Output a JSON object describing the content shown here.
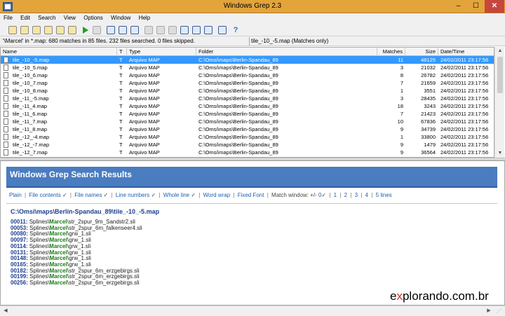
{
  "window": {
    "title": "Windows Grep 2.3",
    "min": "–",
    "max": "☐",
    "close": "✕"
  },
  "menu": [
    "File",
    "Edit",
    "Search",
    "View",
    "Options",
    "Window",
    "Help"
  ],
  "status": {
    "summary": "'\\Marcel' in *.map: 680 matches in 85 files. 232 files searched. 0 files skipped.",
    "selected": "tile_-10_-5.map (Matches only)"
  },
  "columns": {
    "name": "Name",
    "t": "T",
    "type": "Type",
    "folder": "Folder",
    "matches": "Matches",
    "size": "Size",
    "date": "Date/Time"
  },
  "rows": [
    {
      "name": "tile_-10_-5.map",
      "t": "T",
      "type": "Arquivo MAP",
      "folder": "C:\\Omsi\\maps\\Berlin-Spandau_89",
      "matches": "11",
      "size": "48125",
      "date": "24/02/2011 23:17:56",
      "selected": true
    },
    {
      "name": "tile_-10_5.map",
      "t": "T",
      "type": "Arquivo MAP",
      "folder": "C:\\Omsi\\maps\\Berlin-Spandau_89",
      "matches": "3",
      "size": "21032",
      "date": "24/02/2011 23:17:56"
    },
    {
      "name": "tile_-10_6.map",
      "t": "T",
      "type": "Arquivo MAP",
      "folder": "C:\\Omsi\\maps\\Berlin-Spandau_89",
      "matches": "8",
      "size": "26782",
      "date": "24/02/2011 23:17:56"
    },
    {
      "name": "tile_-10_7.map",
      "t": "T",
      "type": "Arquivo MAP",
      "folder": "C:\\Omsi\\maps\\Berlin-Spandau_89",
      "matches": "7",
      "size": "21659",
      "date": "24/02/2011 23:17:56"
    },
    {
      "name": "tile_-10_8.map",
      "t": "T",
      "type": "Arquivo MAP",
      "folder": "C:\\Omsi\\maps\\Berlin-Spandau_89",
      "matches": "1",
      "size": "3551",
      "date": "24/02/2011 23:17:56"
    },
    {
      "name": "tile_-11_-5.map",
      "t": "T",
      "type": "Arquivo MAP",
      "folder": "C:\\Omsi\\maps\\Berlin-Spandau_89",
      "matches": "3",
      "size": "28435",
      "date": "24/02/2011 23:17:56"
    },
    {
      "name": "tile_-11_4.map",
      "t": "T",
      "type": "Arquivo MAP",
      "folder": "C:\\Omsi\\maps\\Berlin-Spandau_89",
      "matches": "18",
      "size": "3243",
      "date": "24/02/2011 23:17:56"
    },
    {
      "name": "tile_-11_6.map",
      "t": "T",
      "type": "Arquivo MAP",
      "folder": "C:\\Omsi\\maps\\Berlin-Spandau_89",
      "matches": "7",
      "size": "21423",
      "date": "24/02/2011 23:17:56"
    },
    {
      "name": "tile_-11_7.map",
      "t": "T",
      "type": "Arquivo MAP",
      "folder": "C:\\Omsi\\maps\\Berlin-Spandau_89",
      "matches": "10",
      "size": "67836",
      "date": "24/02/2011 23:17:56"
    },
    {
      "name": "tile_-11_8.map",
      "t": "T",
      "type": "Arquivo MAP",
      "folder": "C:\\Omsi\\maps\\Berlin-Spandau_89",
      "matches": "9",
      "size": "34739",
      "date": "24/02/2011 23:17:56"
    },
    {
      "name": "tile_-12_-4.map",
      "t": "T",
      "type": "Arquivo MAP",
      "folder": "C:\\Omsi\\maps\\Berlin-Spandau_89",
      "matches": "1",
      "size": "33800",
      "date": "24/02/2011 23:17:56"
    },
    {
      "name": "tile_-12_-7.map",
      "t": "T",
      "type": "Arquivo MAP",
      "folder": "C:\\Omsi\\maps\\Berlin-Spandau_89",
      "matches": "9",
      "size": "1479",
      "date": "24/02/2011 23:17:56"
    },
    {
      "name": "tile_-12_7.map",
      "t": "T",
      "type": "Arquivo MAP",
      "folder": "C:\\Omsi\\maps\\Berlin-Spandau_89",
      "matches": "9",
      "size": "36564",
      "date": "24/02/2011 23:17:56"
    }
  ],
  "results": {
    "heading": "Windows Grep Search Results",
    "options": {
      "plain": "Plain",
      "file_contents": "File contents",
      "file_names": "File names",
      "line_numbers": "Line numbers",
      "whole_line": "Whole line",
      "word_wrap": "Word wrap",
      "fixed_font": "Fixed Font",
      "match_window": "Match window: +/-",
      "mw_values": [
        "0",
        "1",
        "2",
        "3",
        "4",
        "5 lines"
      ],
      "check": "✓",
      "separator": "|"
    },
    "file_path": "C:\\Omsi\\maps\\Berlin-Spandau_89\\tile_-10_-5.map",
    "matches": [
      {
        "line": "00011:",
        "pre": "Splines\\",
        "hit": "Marcel",
        "post": "\\str_2spur_9m_Sandstr2.sli"
      },
      {
        "line": "00053:",
        "pre": "Splines\\",
        "hit": "Marcel",
        "post": "\\str_2spur_6m_falkenseer4.sli"
      },
      {
        "line": "00080:",
        "pre": "Splines\\",
        "hit": "Marcel",
        "post": "\\grw_1.sli"
      },
      {
        "line": "00097:",
        "pre": "Splines\\",
        "hit": "Marcel",
        "post": "\\grw_1.sli"
      },
      {
        "line": "00114:",
        "pre": "Splines\\",
        "hit": "Marcel",
        "post": "\\grw_1.sli"
      },
      {
        "line": "00131:",
        "pre": "Splines\\",
        "hit": "Marcel",
        "post": "\\grw_1.sli"
      },
      {
        "line": "00148:",
        "pre": "Splines\\",
        "hit": "Marcel",
        "post": "\\grw_1.sli"
      },
      {
        "line": "00165:",
        "pre": "Splines\\",
        "hit": "Marcel",
        "post": "\\grw_1.sli"
      },
      {
        "line": "00182:",
        "pre": "Splines\\",
        "hit": "Marcel",
        "post": "\\str_2spur_6m_erzgebirgs.sli"
      },
      {
        "line": "00199:",
        "pre": "Splines\\",
        "hit": "Marcel",
        "post": "\\str_2spur_6m_erzgebirgs.sli"
      },
      {
        "line": "00256:",
        "pre": "Splines\\",
        "hit": "Marcel",
        "post": "\\str_2spur_6m_erzgebirgs.sli"
      }
    ]
  },
  "watermark": {
    "pre": "e",
    "x": "x",
    "post": "plorando.com.br"
  },
  "colors": {
    "titlebar": "#e2a43b",
    "close": "#c7463e",
    "selection": "#3399ff",
    "banner": "#4a7cc0",
    "highlight": "#1a7a1a",
    "watermark_x": "#d4371f"
  }
}
